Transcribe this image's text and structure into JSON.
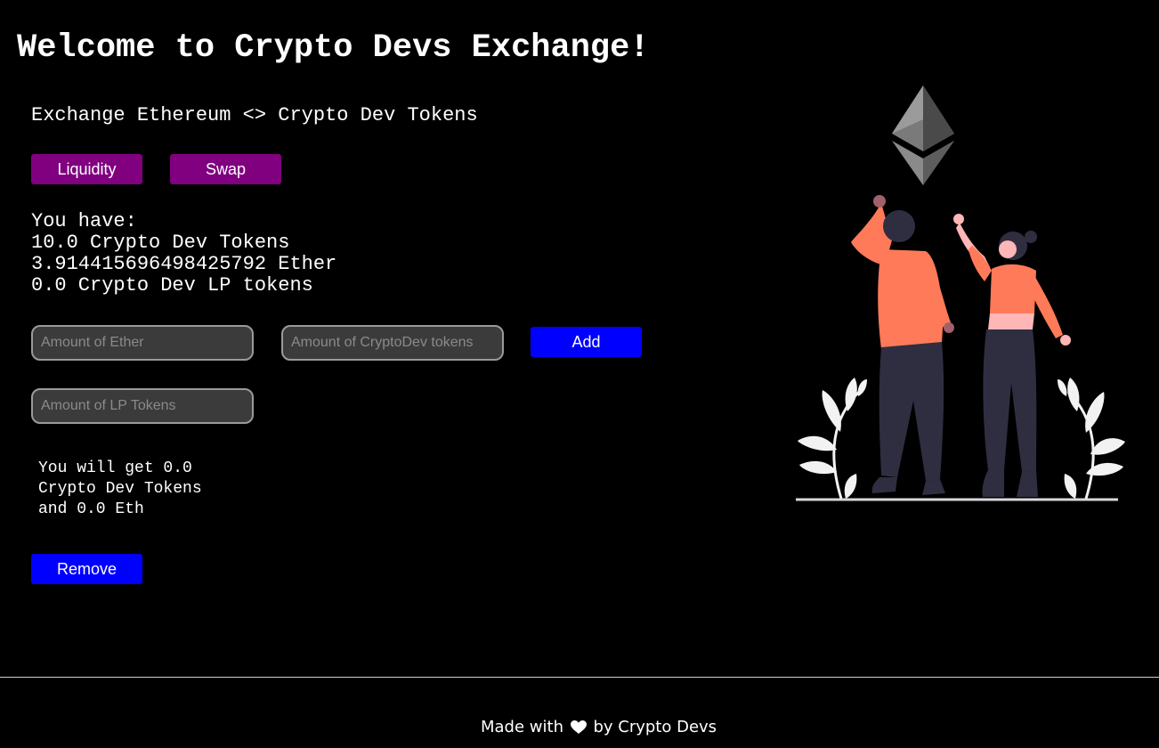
{
  "header": {
    "title": "Welcome to Crypto Devs Exchange!",
    "subtitle": "Exchange Ethereum <> Crypto Dev Tokens"
  },
  "tabs": {
    "liquidity_label": "Liquidity",
    "swap_label": "Swap"
  },
  "balances": {
    "heading": "You have:",
    "crypto_dev_tokens": "10.0 Crypto Dev Tokens",
    "ether": "3.914415696498425792 Ether",
    "lp_tokens": "0.0 Crypto Dev LP tokens"
  },
  "add_liquidity": {
    "ether_placeholder": "Amount of Ether",
    "tokens_placeholder": "Amount of CryptoDev tokens",
    "add_label": "Add"
  },
  "remove_liquidity": {
    "lp_placeholder": "Amount of LP Tokens",
    "receive_line1": "You will get 0.0",
    "receive_line2": "Crypto Dev Tokens",
    "receive_line3": "and 0.0 Eth",
    "remove_label": "Remove"
  },
  "footer": {
    "prefix": "Made with",
    "heart_icon": "heart-icon",
    "suffix": "by Crypto Devs"
  },
  "colors": {
    "background": "#000000",
    "tab_button": "#800080",
    "action_button": "#0000ff",
    "figure_shirt": "#ff7a59",
    "figure_pants": "#2f2e41"
  }
}
